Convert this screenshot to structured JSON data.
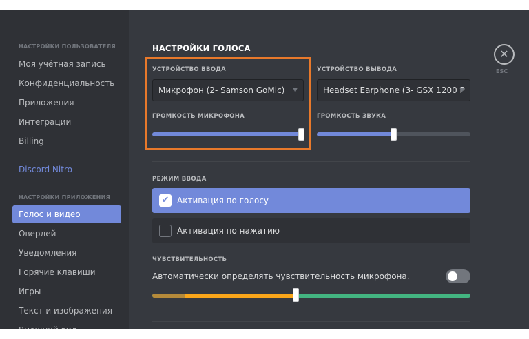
{
  "sidebar": {
    "user_header": "Настройки пользователя",
    "user_items": [
      "Моя учётная запись",
      "Конфиденциальность",
      "Приложения",
      "Интеграции",
      "Billing"
    ],
    "nitro": "Discord Nitro",
    "app_header": "Настройки приложения",
    "app_items": [
      "Голос и видео",
      "Оверлей",
      "Уведомления",
      "Горячие клавиши",
      "Игры",
      "Текст и изображения",
      "Внешний вид"
    ],
    "active_item": "Голос и видео"
  },
  "main": {
    "title": "Настройки голоса",
    "input_device_label": "Устройство ввода",
    "input_device_value": "Микрофон (2- Samson GoMic)",
    "output_device_label": "Устройство вывода",
    "output_device_value": "Headset Earphone (3- GSX 1200 P",
    "input_volume_label": "Громкость микрофона",
    "input_volume_level": 1.0,
    "output_volume_label": "Громкость звука",
    "output_volume_level": 0.5,
    "input_mode_label": "Режим ввода",
    "voice_activity": "Активация по голосу",
    "push_to_talk": "Активация по нажатию",
    "selected_mode": "voice_activity",
    "sensitivity_label": "Чувствительность",
    "auto_sensitivity_text": "Автоматически определять чувствительность микрофона.",
    "auto_sensitivity_on": false,
    "sensitivity_level": 0.45,
    "close_label": "ESC"
  },
  "icons": {
    "close": "close-icon",
    "dropdown": "chevron-down-icon",
    "check": "checkmark-icon"
  },
  "colors": {
    "accent": "#7289da",
    "highlight_box": "#e8792b",
    "sidebar_bg": "#2f3136",
    "main_bg": "#36393f",
    "sensitivity_green": "#43b581",
    "sensitivity_yellow": "#faa61a"
  }
}
